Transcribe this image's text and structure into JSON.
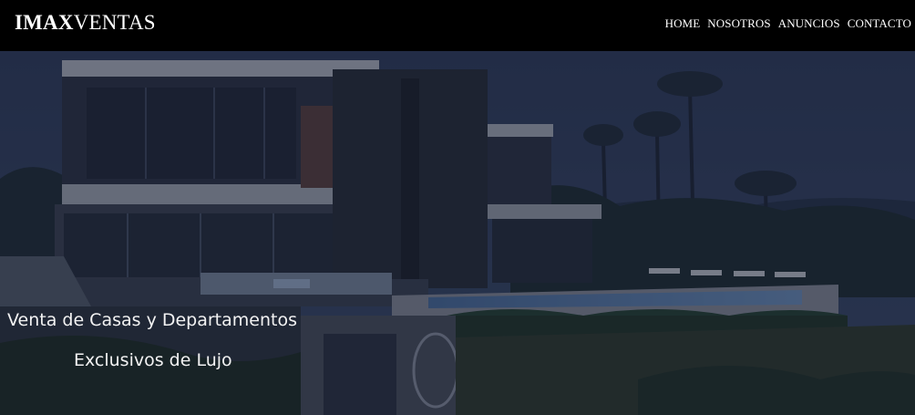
{
  "header": {
    "logo_bold": "IMAX",
    "logo_light": "VENTAS",
    "nav": [
      {
        "label": "HOME"
      },
      {
        "label": "NOSOTROS"
      },
      {
        "label": "ANUNCIOS"
      },
      {
        "label": "CONTACTO"
      }
    ]
  },
  "hero": {
    "title": "Venta de Casas y Departamentos",
    "subtitle": "Exclusivos de Lujo"
  },
  "colors": {
    "header_bg": "#000000",
    "text": "#ffffff",
    "overlay": "#141a2d"
  }
}
